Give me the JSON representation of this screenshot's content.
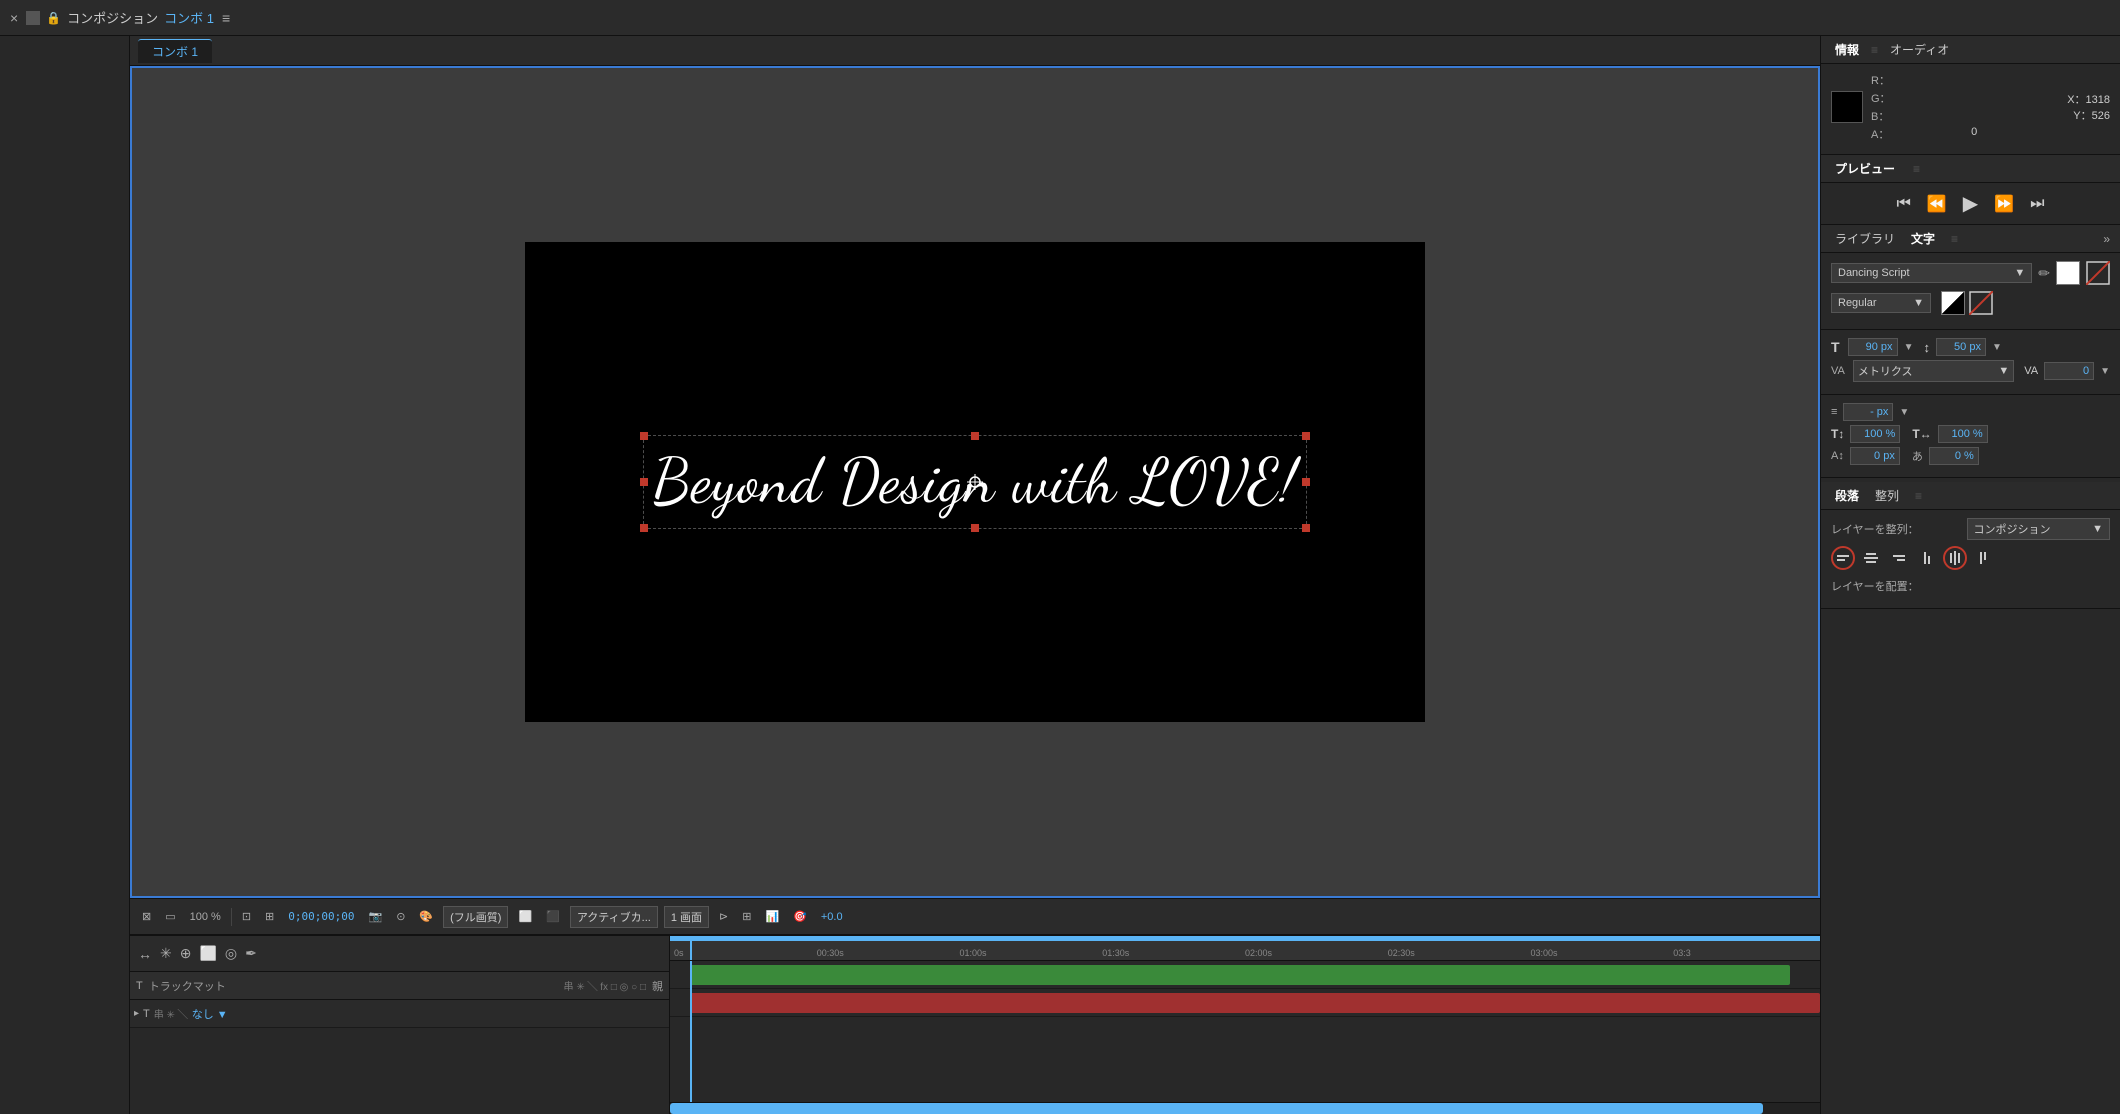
{
  "topbar": {
    "close_label": "×",
    "title": "コンポジション",
    "title_accent": "コンボ 1",
    "menu_icon": "≡"
  },
  "viewer_tab": {
    "label": "コンボ 1"
  },
  "comp_text": "Beyond Design with LOVE!",
  "viewer_controls": {
    "magnify": "100 %",
    "timecode": "0;00;00;00",
    "quality": "(フル画質)",
    "layout": "1 画面",
    "sync": "+0.0",
    "active_camera": "アクティブカ..."
  },
  "info_panel": {
    "tab1": "情報",
    "tab2": "オーディオ",
    "r_label": "R：",
    "g_label": "G：",
    "b_label": "B：",
    "a_label": "A：",
    "r_value": "",
    "g_value": "",
    "b_value": "",
    "a_value": "0",
    "x_label": "X：1318",
    "y_label": "Y：526"
  },
  "preview_panel": {
    "tab": "プレビュー",
    "menu_icon": "≡"
  },
  "library_tab": "ライブラリ",
  "char_panel": {
    "tab": "文字",
    "menu_icon": "≡",
    "expand_icon": "»",
    "font_name": "Dancing Script",
    "font_style": "Regular",
    "size_label": "90 px",
    "size_value": "90 px",
    "leading_value": "50 px",
    "tracking_label": "メトリクス",
    "tracking_value": "0",
    "indent_label": "- px",
    "vert_scale": "100 %",
    "horiz_scale": "100 %",
    "baseline_shift": "0 px",
    "tsume": "0 %"
  },
  "paragraph_panel": {
    "tab1": "段落",
    "tab2": "整列",
    "menu_icon": "≡",
    "layer_align_label": "レイヤーを整列：",
    "align_target": "コンポジション",
    "layer_place_label": "レイヤーを配置："
  },
  "timeline": {
    "toolbar_icons": [
      "↔",
      "✳",
      "⊕",
      "□",
      "◎",
      "□"
    ],
    "layer_header": {
      "type": "T",
      "track_matte": "トラックマット",
      "icons": "串 ✳ ╲ fx □ ◎ ○ □",
      "parent": "親"
    },
    "layer": {
      "type": "T",
      "icons": "串 ✳ ╲",
      "parent": "なし"
    },
    "ruler_marks": [
      "0s",
      "00:30s",
      "01:00s",
      "01:30s",
      "02:00s",
      "02:30s",
      "03:00s",
      "03:3"
    ]
  }
}
